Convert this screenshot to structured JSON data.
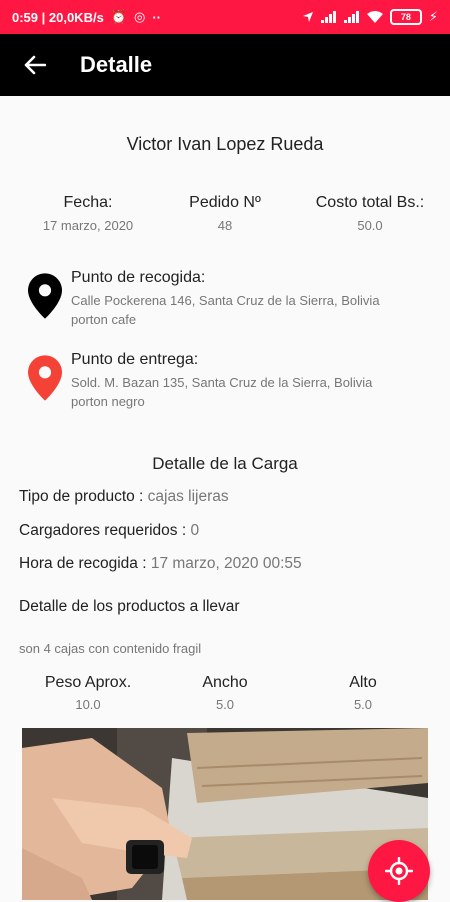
{
  "status_bar": {
    "time_speed": "0:59 | 20,0KB/s",
    "extra": "··",
    "battery": "78"
  },
  "app_bar": {
    "title": "Detalle",
    "back_icon": "arrow-left-icon"
  },
  "order": {
    "customer_name": "Victor Ivan Lopez Rueda",
    "fecha_label": "Fecha:",
    "fecha_value": "17 marzo, 2020",
    "pedido_label": "Pedido Nº",
    "pedido_value": "48",
    "costo_label": "Costo total Bs.:",
    "costo_value": "50.0"
  },
  "pickup": {
    "title": "Punto de recogida:",
    "address": "Calle Pockerena 146, Santa Cruz de la Sierra, Bolivia",
    "reference": "porton cafe",
    "pin_color": "#000000"
  },
  "delivery": {
    "title": "Punto de entrega:",
    "address": "Sold. M. Bazan 135, Santa Cruz de la Sierra, Bolivia",
    "reference": "porton negro",
    "pin_color": "#f44336"
  },
  "cargo": {
    "section_title": "Detalle de la Carga",
    "tipo_label": "Tipo de producto : ",
    "tipo_value": "cajas lijeras",
    "cargadores_label": "Cargadores requeridos : ",
    "cargadores_value": "0",
    "hora_label": "Hora de recogida : ",
    "hora_value": "17 marzo, 2020 00:55",
    "productos_label": "Detalle de los productos a llevar",
    "productos_note": "son 4 cajas con contenido fragil"
  },
  "dimensions": {
    "peso_label": "Peso Aprox.",
    "peso_value": "10.0",
    "ancho_label": "Ancho",
    "ancho_value": "5.0",
    "alto_label": "Alto",
    "alto_value": "5.0"
  },
  "colors": {
    "accent": "#ff1744",
    "appbar": "#000000"
  },
  "fab": {
    "icon": "my-location-icon"
  }
}
